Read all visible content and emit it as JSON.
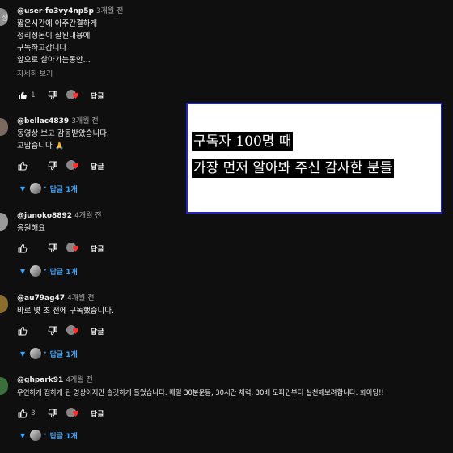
{
  "comments": [
    {
      "avatar": "정",
      "author": "@user-fo3vy4np5p",
      "time": "3개월 전",
      "text": "짧은시간에 아주간결하게\n정리정돈이 잘된내용에\n구독하고갑니다\n앞으로 살아가는동안...",
      "more": "자세히 보기",
      "likes": "1",
      "reply": "답글"
    },
    {
      "author": "@bellac4839",
      "time": "3개월 전",
      "text": "동영상 보고 감동받았습니다.\n고맙습니다 🙏",
      "likes": "",
      "reply": "답글",
      "replies": "답글 1개"
    },
    {
      "author": "@junoko8892",
      "time": "4개월 전",
      "text": "응원해요",
      "likes": "",
      "reply": "답글",
      "replies": "답글 1개"
    },
    {
      "author": "@au79ag47",
      "time": "4개월 전",
      "text": "바로 몇 초 전에 구독했습니다.",
      "likes": "",
      "reply": "답글",
      "replies": "답글 1개"
    },
    {
      "author": "@ghpark91",
      "time": "4개월 전",
      "text": "우연하게 접하게 된 영상이지만 솔깃하게 들었습니다. 매일 30분운동, 30시간 체력, 30배 도파민부터 실천해보려합니다. 화이팅!!",
      "likes": "3",
      "reply": "답글",
      "replies": "답글 1개"
    }
  ],
  "overlay": {
    "line1": "구독자 100명 때",
    "line2": "가장 먼저 알아봐 주신 감사한 분들"
  },
  "icons": {
    "like": "thumbs-up-icon",
    "dislike": "thumbs-down-icon",
    "heart": "creator-heart-icon",
    "expand": "chevron-down-icon"
  },
  "colors": {
    "background": "#0f0f0f",
    "link": "#3ea6ff",
    "heart": "#ff2d2d",
    "card_border": "#2326b8"
  }
}
